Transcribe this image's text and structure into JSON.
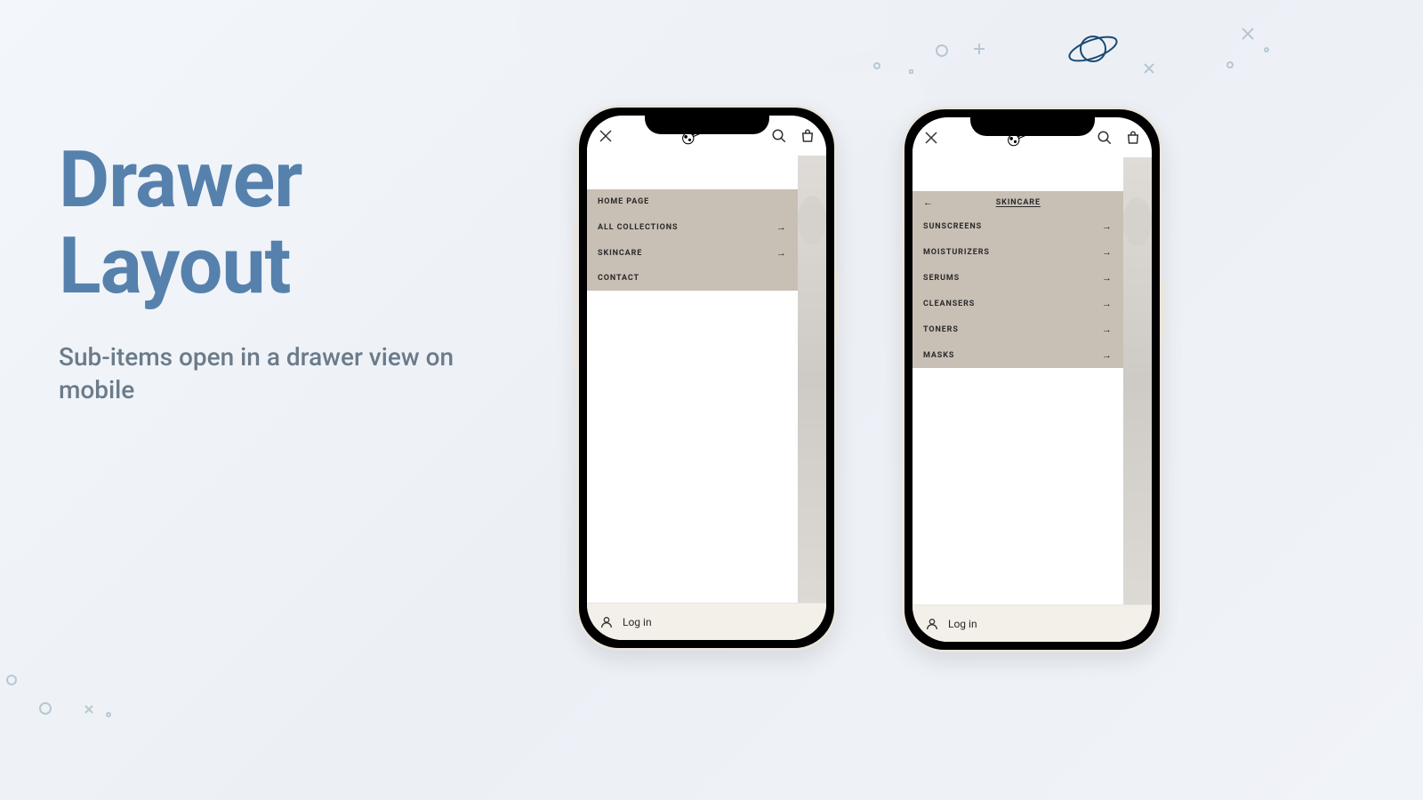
{
  "headline": {
    "line1": "Drawer",
    "line2": "Layout"
  },
  "subhead": "Sub-items open in a drawer view on mobile",
  "left_phone": {
    "menu": [
      {
        "label": "HOME PAGE",
        "has_children": false
      },
      {
        "label": "ALL COLLECTIONS",
        "has_children": true
      },
      {
        "label": "SKINCARE",
        "has_children": true
      },
      {
        "label": "CONTACT",
        "has_children": false
      }
    ],
    "footer_login": "Log in"
  },
  "right_phone": {
    "sub_title": "SKINCARE",
    "menu": [
      {
        "label": "SUNSCREENS",
        "has_children": true
      },
      {
        "label": "MOISTURIZERS",
        "has_children": true
      },
      {
        "label": "SERUMS",
        "has_children": true
      },
      {
        "label": "CLEANSERS",
        "has_children": true
      },
      {
        "label": "TONERS",
        "has_children": true
      },
      {
        "label": "MASKS",
        "has_children": true
      }
    ],
    "footer_login": "Log in"
  }
}
